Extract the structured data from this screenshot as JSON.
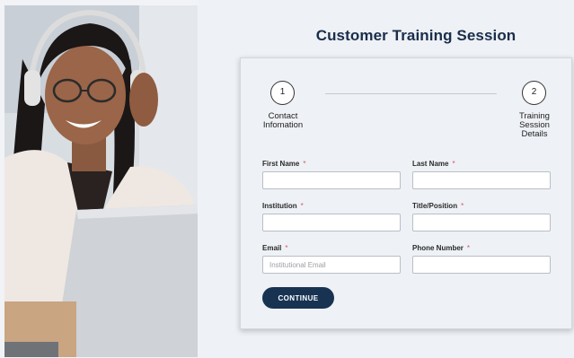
{
  "page": {
    "title": "Customer Training Session"
  },
  "steps": [
    {
      "number": "1",
      "label_lines": [
        "Contact",
        "Infomation"
      ]
    },
    {
      "number": "2",
      "label_lines": [
        "Training",
        "Session",
        "Details"
      ]
    }
  ],
  "form": {
    "fields": {
      "first_name": {
        "label": "First Name",
        "required_mark": "*",
        "value": "",
        "placeholder": ""
      },
      "last_name": {
        "label": "Last Name",
        "required_mark": "*",
        "value": "",
        "placeholder": ""
      },
      "institution": {
        "label": "Institution",
        "required_mark": "*",
        "value": "",
        "placeholder": ""
      },
      "title_position": {
        "label": "Title/Position",
        "required_mark": "*",
        "value": "",
        "placeholder": ""
      },
      "email": {
        "label": "Email",
        "required_mark": "*",
        "value": "",
        "placeholder": "Institutional Email"
      },
      "phone": {
        "label": "Phone Number",
        "required_mark": "*",
        "value": "",
        "placeholder": ""
      }
    },
    "continue_label": "CONTINUE"
  },
  "colors": {
    "brand_navy": "#183352",
    "title_navy": "#1a2d4a",
    "required_red": "#d25a5a",
    "background": "#eef1f5"
  },
  "photo": {
    "subject": "woman-with-headphones-at-laptop"
  }
}
